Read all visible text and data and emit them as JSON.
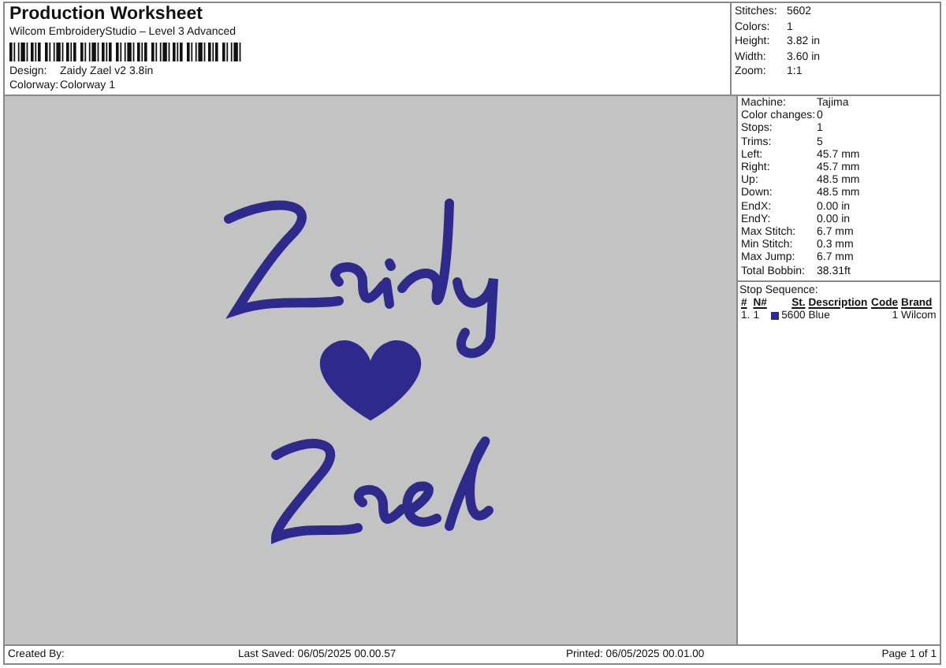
{
  "header": {
    "title": "Production Worksheet",
    "subtitle": "Wilcom EmbroideryStudio – Level 3 Advanced",
    "fields": [
      {
        "label": "Design:",
        "value": "Zaidy Zael v2 3.8in"
      },
      {
        "label": "Colorway:",
        "value": "Colorway 1"
      }
    ]
  },
  "summary": [
    {
      "label": "Stitches:",
      "value": "5602"
    },
    {
      "label": "Colors:",
      "value": "1"
    },
    {
      "label": "Height:",
      "value": "3.82 in"
    },
    {
      "label": "Width:",
      "value": "3.60 in"
    },
    {
      "label": "Zoom:",
      "value": "1:1"
    }
  ],
  "details": [
    {
      "label": "Machine:",
      "value": "Tajima"
    },
    {
      "label": "Color changes:",
      "value": "0"
    },
    {
      "label": "Stops:",
      "value": "1"
    },
    {
      "label": "Trims:",
      "value": "5"
    },
    {
      "label": "Left:",
      "value": "45.7 mm"
    },
    {
      "label": "Right:",
      "value": "45.7 mm"
    },
    {
      "label": "Up:",
      "value": "48.5 mm"
    },
    {
      "label": "Down:",
      "value": "48.5 mm"
    },
    {
      "label": "EndX:",
      "value": "0.00 in"
    },
    {
      "label": "EndY:",
      "value": "0.00 in"
    },
    {
      "label": "Max Stitch:",
      "value": "6.7 mm"
    },
    {
      "label": "Min Stitch:",
      "value": "0.3 mm"
    },
    {
      "label": "Max Jump:",
      "value": "6.7 mm"
    },
    {
      "label": "Total Bobbin:",
      "value": "38.31ft"
    }
  ],
  "stop_sequence": {
    "title": "Stop Sequence:",
    "columns": [
      "#",
      "N#",
      "St.",
      "Description",
      "Code",
      "Brand"
    ],
    "rows": [
      {
        "index": "1.",
        "needle": "1",
        "color": "#2e2a8c",
        "stitches": "5600",
        "description": "Blue",
        "code": "1",
        "brand": "Wilcom"
      }
    ]
  },
  "footer": {
    "created_by": "Created By:",
    "last_saved": "Last Saved: 06/05/2025 00.00.57",
    "printed": "Printed: 06/05/2025 00.01.00",
    "page": "Page 1 of 1"
  }
}
